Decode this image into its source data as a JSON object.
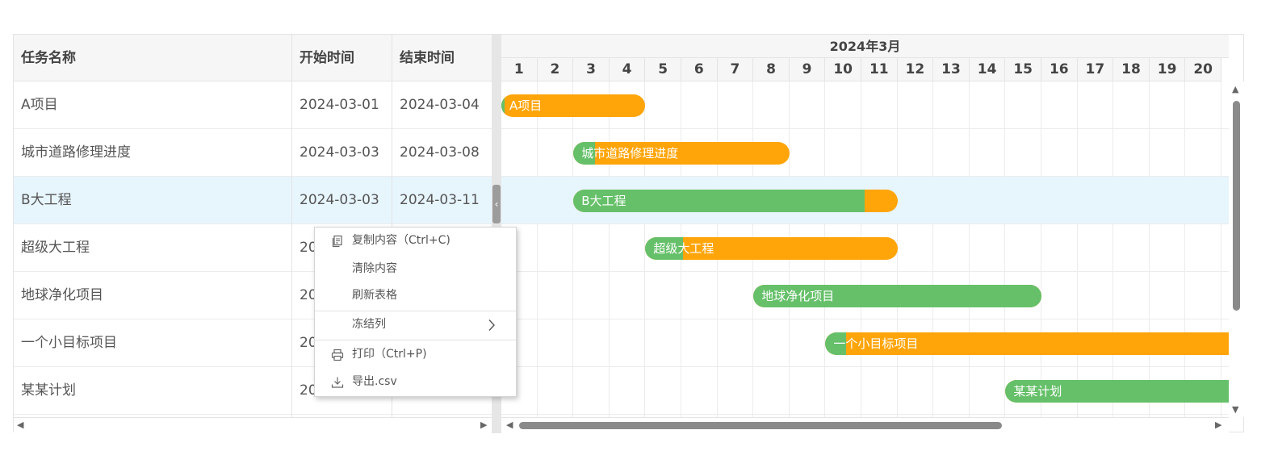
{
  "table": {
    "headers": [
      "任务名称",
      "开始时间",
      "结束时间"
    ],
    "rows": [
      {
        "name": "A项目",
        "start": "2024-03-01",
        "end": "2024-03-04"
      },
      {
        "name": "城市道路修理进度",
        "start": "2024-03-03",
        "end": "2024-03-08"
      },
      {
        "name": "B大工程",
        "start": "2024-03-03",
        "end": "2024-03-11"
      },
      {
        "name": "超级大工程",
        "start": "20",
        "end": ""
      },
      {
        "name": "地球净化项目",
        "start": "20",
        "end": ""
      },
      {
        "name": "一个小目标项目",
        "start": "20",
        "end": ""
      },
      {
        "name": "某某计划",
        "start": "20",
        "end": ""
      }
    ],
    "selected_row": 2
  },
  "timeline": {
    "month": "2024年3月",
    "days": [
      "1",
      "2",
      "3",
      "4",
      "5",
      "6",
      "7",
      "8",
      "9",
      "10",
      "11",
      "12",
      "13",
      "14",
      "15",
      "16",
      "17",
      "18",
      "19",
      "20"
    ]
  },
  "tasks": [
    {
      "label": "A项目",
      "progress": 0.02
    },
    {
      "label": "城市道路修理进度",
      "progress": 0.1
    },
    {
      "label": "B大工程",
      "progress": 0.9
    },
    {
      "label": "超级大工程",
      "progress": 0.15
    },
    {
      "label": "地球净化项目",
      "progress": 1.0
    },
    {
      "label": "一个小目标项目",
      "progress": 0.05
    },
    {
      "label": "某某计划",
      "progress": 1.0
    }
  ],
  "context_menu": {
    "copy": "复制内容（Ctrl+C)",
    "clear": "清除内容",
    "refresh": "刷新表格",
    "freeze": "冻结列",
    "print": "打印（Ctrl+P)",
    "export": "导出.csv"
  },
  "colors": {
    "bar": "#ffa50a",
    "progress": "#66c06a",
    "highlight": "#e7f5fd",
    "header_bg": "#f6f6f6"
  }
}
